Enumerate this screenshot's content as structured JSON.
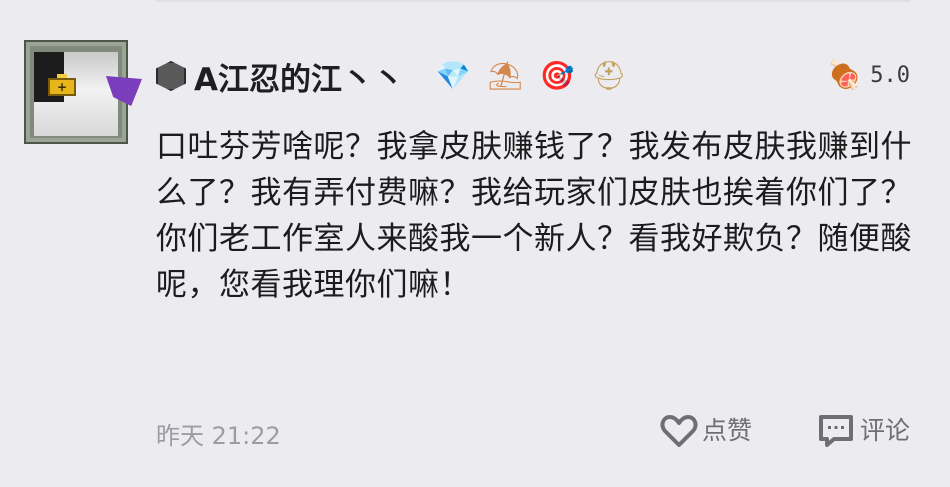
{
  "post": {
    "username": "A江忍的江丶丶",
    "level_icon": "stone-block-icon",
    "badges": [
      {
        "name": "gem-crown-icon",
        "glyph": "💎"
      },
      {
        "name": "beach-umbrella-icon",
        "glyph": "⛱"
      },
      {
        "name": "target-badge-icon",
        "glyph": "🎯"
      },
      {
        "name": "helmet-icon",
        "glyph": "⛑"
      }
    ],
    "rating_icon": "meat-icon",
    "rating_glyph": "🍖",
    "rating": "5.0",
    "comment": "口吐芬芳啥呢？我拿皮肤赚钱了？我发布皮肤我赚到什么了？我有弄付费嘛？我给玩家们皮肤也挨着你们了？你们老工作室人来酸我一个新人？看我好欺负？随便酸呢，您看我理你们嘛！",
    "timestamp": "昨天  21:22",
    "like_label": "点赞",
    "comment_label": "评论"
  },
  "colors": {
    "background": "#ecebf0",
    "text": "#1c1c1c",
    "muted": "#9c9ca2",
    "action": "#6e6e74"
  }
}
